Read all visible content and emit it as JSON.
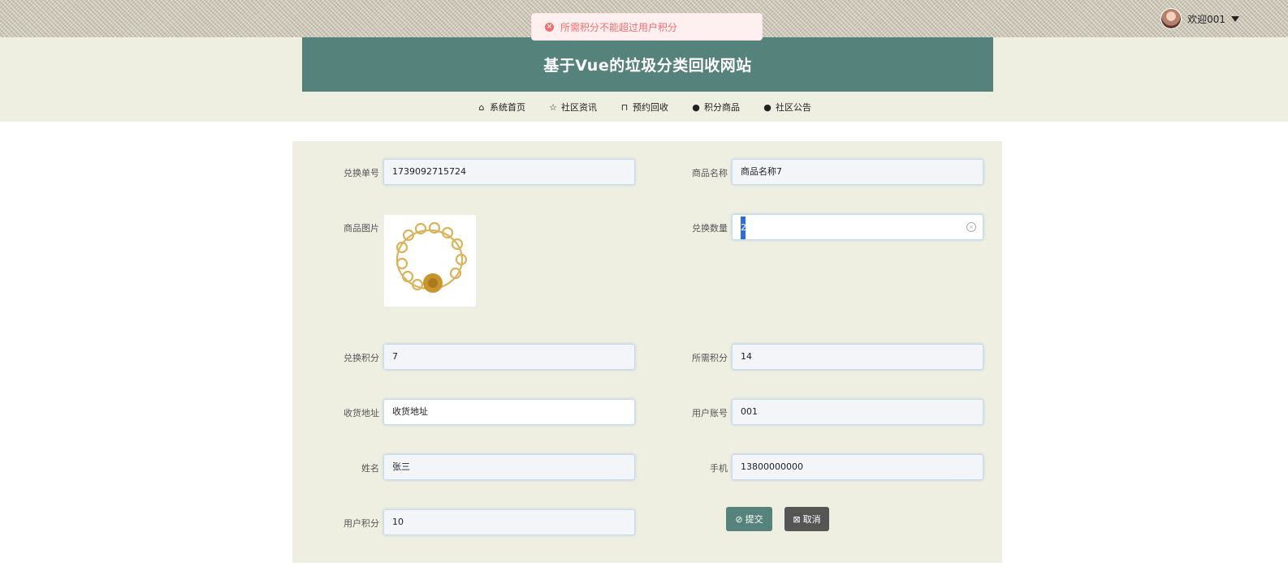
{
  "header": {
    "user_name": "欢迎001",
    "title": "基于Vue的垃圾分类回收网站"
  },
  "toast": {
    "message": "所需积分不能超过用户积分",
    "type": "error"
  },
  "nav": {
    "items": [
      {
        "label": "系统首页",
        "icon": "home-icon"
      },
      {
        "label": "社区资讯",
        "icon": "star-icon"
      },
      {
        "label": "预约回收",
        "icon": "bag-icon"
      },
      {
        "label": "积分商品",
        "icon": "info-icon"
      },
      {
        "label": "社区公告",
        "icon": "question-icon"
      }
    ]
  },
  "form": {
    "exchange_no_label": "兑换单号",
    "exchange_no_value": "1739092715724",
    "goods_name_label": "商品名称",
    "goods_name_value": "商品名称7",
    "goods_image_label": "商品图片",
    "quantity_label": "兑换数量",
    "quantity_value": "2",
    "exchange_points_label": "兑换积分",
    "exchange_points_value": "7",
    "required_points_label": "所需积分",
    "required_points_value": "14",
    "address_label": "收货地址",
    "address_value": "收货地址",
    "account_label": "用户账号",
    "account_value": "001",
    "name_label": "姓名",
    "name_value": "张三",
    "phone_label": "手机",
    "phone_value": "13800000000",
    "user_points_label": "用户积分",
    "user_points_value": "10",
    "submit_label": "提交",
    "cancel_label": "取消"
  },
  "colors": {
    "primary": "#55827a",
    "band": "#eeeee1",
    "error": "#f56c6c",
    "cancel": "#555555"
  }
}
